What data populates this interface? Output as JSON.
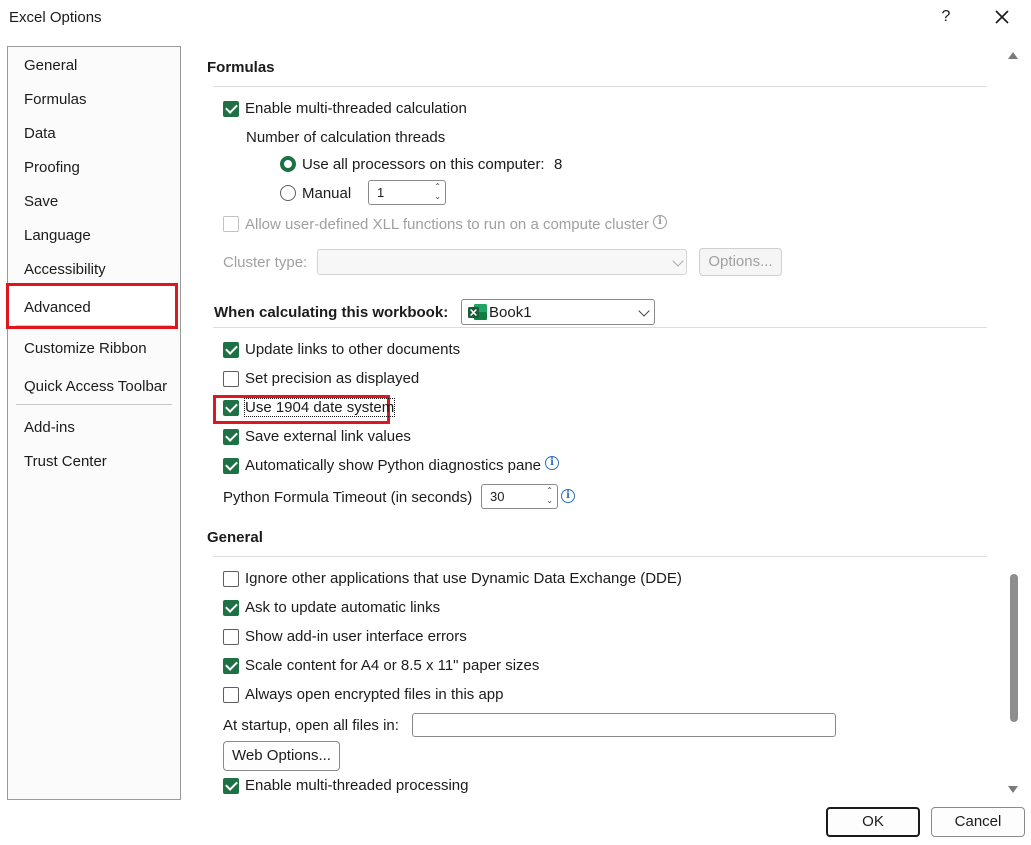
{
  "window": {
    "title": "Excel Options",
    "help": "?"
  },
  "nav": {
    "items": [
      {
        "label": "General"
      },
      {
        "label": "Formulas"
      },
      {
        "label": "Data"
      },
      {
        "label": "Proofing"
      },
      {
        "label": "Save"
      },
      {
        "label": "Language"
      },
      {
        "label": "Accessibility"
      },
      {
        "label": "Advanced",
        "selected": true
      },
      {
        "label": "Customize Ribbon"
      },
      {
        "label": "Quick Access Toolbar"
      },
      {
        "label": "Add-ins"
      },
      {
        "label": "Trust Center"
      }
    ]
  },
  "formulas": {
    "title": "Formulas",
    "multithread": {
      "label": "Enable multi-threaded calculation",
      "checked": true
    },
    "threads_label": "Number of calculation threads",
    "all_processors": {
      "label": "Use all processors on this computer:",
      "value": "8",
      "selected": true
    },
    "manual": {
      "label": "Manual",
      "value": "1",
      "selected": false
    },
    "xll": {
      "label": "Allow user-defined XLL functions to run on a compute cluster",
      "checked": false,
      "disabled": true
    },
    "cluster_type": {
      "label": "Cluster type:",
      "options_button": "Options..."
    }
  },
  "workbook": {
    "title": "When calculating this workbook:",
    "selected": "Book1",
    "options": [
      {
        "label": "Update links to other documents",
        "checked": true
      },
      {
        "label": "Set precision as displayed",
        "checked": false
      },
      {
        "label": "Use 1904 date system",
        "checked": true,
        "highlighted": true
      },
      {
        "label": "Save external link values",
        "checked": true
      },
      {
        "label": "Automatically show Python diagnostics pane",
        "checked": true
      }
    ],
    "python_timeout": {
      "label": "Python Formula Timeout (in seconds)",
      "value": "30"
    }
  },
  "general": {
    "title": "General",
    "options": [
      {
        "label": "Ignore other applications that use Dynamic Data Exchange (DDE)",
        "checked": false
      },
      {
        "label": "Ask to update automatic links",
        "checked": true
      },
      {
        "label": "Show add-in user interface errors",
        "checked": false
      },
      {
        "label": "Scale content for A4 or 8.5 x 11\" paper sizes",
        "checked": true
      },
      {
        "label": "Always open encrypted files in this app",
        "checked": false
      }
    ],
    "startup_label": "At startup, open all files in:",
    "startup_value": "",
    "web_options": "Web Options...",
    "multiprocess": {
      "label": "Enable multi-threaded processing",
      "checked": true
    }
  },
  "buttons": {
    "ok": "OK",
    "cancel": "Cancel"
  },
  "colors": {
    "accent": "#1e7145",
    "highlight": "#e0161e",
    "info": "#2a6ebd"
  }
}
